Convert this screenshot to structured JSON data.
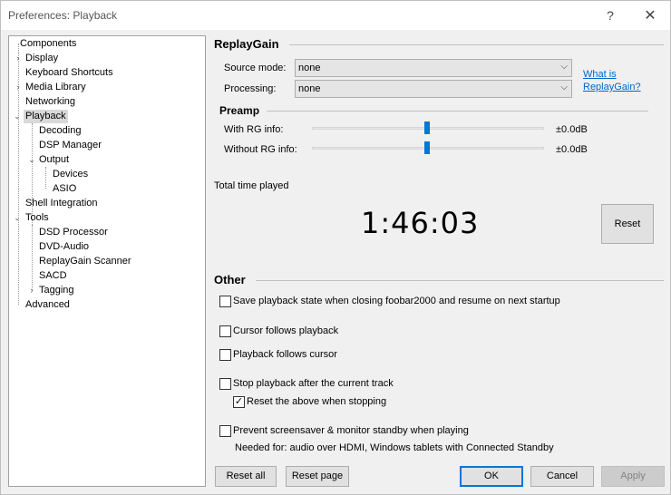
{
  "window": {
    "title": "Preferences: Playback",
    "help_glyph": "?",
    "close_glyph": "✕"
  },
  "tree": {
    "items": [
      {
        "label": "Components"
      },
      {
        "label": "Display"
      },
      {
        "label": "Keyboard Shortcuts"
      },
      {
        "label": "Media Library"
      },
      {
        "label": "Networking"
      },
      {
        "label": "Playback"
      },
      {
        "label": "Decoding"
      },
      {
        "label": "DSP Manager"
      },
      {
        "label": "Output"
      },
      {
        "label": "Devices"
      },
      {
        "label": "ASIO"
      },
      {
        "label": "Shell Integration"
      },
      {
        "label": "Tools"
      },
      {
        "label": "DSD Processor"
      },
      {
        "label": "DVD-Audio"
      },
      {
        "label": "ReplayGain Scanner"
      },
      {
        "label": "SACD"
      },
      {
        "label": "Tagging"
      },
      {
        "label": "Advanced"
      }
    ]
  },
  "replaygain": {
    "heading": "ReplayGain",
    "source_mode_label": "Source mode:",
    "source_mode_value": "none",
    "processing_label": "Processing:",
    "processing_value": "none",
    "link_line1": "What is",
    "link_line2": "ReplayGain?",
    "preamp_heading": "Preamp",
    "with_rg_label": "With RG info:",
    "with_rg_value": "±0.0dB",
    "without_rg_label": "Without RG info:",
    "without_rg_value": "±0.0dB"
  },
  "total_time": {
    "label": "Total time played",
    "value": "1:46:03",
    "reset_label": "Reset"
  },
  "other": {
    "heading": "Other",
    "options": [
      {
        "label": "Save playback state when closing foobar2000 and resume on next startup",
        "checked": false
      },
      {
        "label": "Cursor follows playback",
        "checked": false
      },
      {
        "label": "Playback follows cursor",
        "checked": false
      },
      {
        "label": "Stop playback after the current track",
        "checked": false
      },
      {
        "label": "Reset the above when stopping",
        "checked": true
      },
      {
        "label": "Prevent screensaver & monitor standby when playing",
        "checked": false
      }
    ],
    "note": "Needed for: audio over HDMI, Windows tablets with Connected Standby"
  },
  "footer": {
    "reset_all": "Reset all",
    "reset_page": "Reset page",
    "ok": "OK",
    "cancel": "Cancel",
    "apply": "Apply"
  }
}
